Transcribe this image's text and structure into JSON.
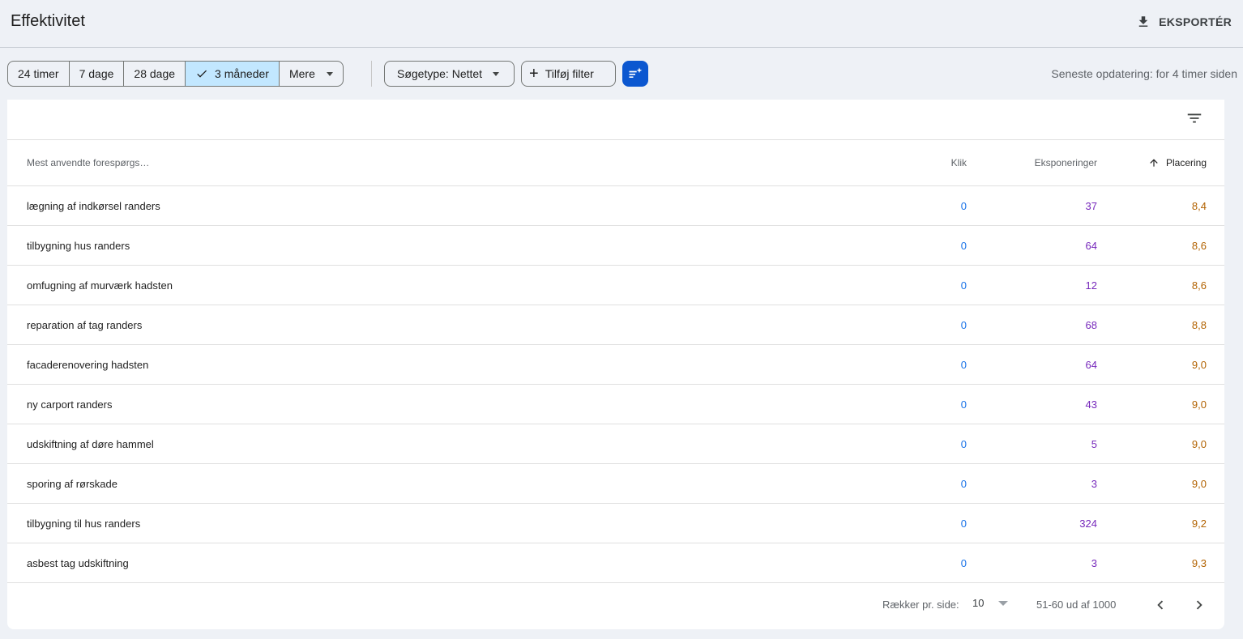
{
  "header": {
    "title": "Effektivitet",
    "export_label": "EKSPORTÉR"
  },
  "filters": {
    "date_ranges": [
      "24 timer",
      "7 dage",
      "28 dage",
      "3 måneder"
    ],
    "selected_range": "3 måneder",
    "more_label": "Mere",
    "search_type_label": "Søgetype: Nettet",
    "add_filter_label": "Tilføj filter",
    "last_update": "Seneste opdatering: for 4 timer siden"
  },
  "table": {
    "columns": {
      "query": "Mest anvendte forespørgs…",
      "clicks": "Klik",
      "impressions": "Eksponeringer",
      "position": "Placering"
    },
    "sort": {
      "column": "position",
      "direction": "ascending"
    },
    "rows": [
      {
        "query": "lægning af indkørsel randers",
        "clicks": "0",
        "impressions": "37",
        "position": "8,4"
      },
      {
        "query": "tilbygning hus randers",
        "clicks": "0",
        "impressions": "64",
        "position": "8,6"
      },
      {
        "query": "omfugning af murværk hadsten",
        "clicks": "0",
        "impressions": "12",
        "position": "8,6"
      },
      {
        "query": "reparation af tag randers",
        "clicks": "0",
        "impressions": "68",
        "position": "8,8"
      },
      {
        "query": "facaderenovering hadsten",
        "clicks": "0",
        "impressions": "64",
        "position": "9,0"
      },
      {
        "query": "ny carport randers",
        "clicks": "0",
        "impressions": "43",
        "position": "9,0"
      },
      {
        "query": "udskiftning af døre hammel",
        "clicks": "0",
        "impressions": "5",
        "position": "9,0"
      },
      {
        "query": "sporing af rørskade",
        "clicks": "0",
        "impressions": "3",
        "position": "9,0"
      },
      {
        "query": "tilbygning til hus randers",
        "clicks": "0",
        "impressions": "324",
        "position": "9,2"
      },
      {
        "query": "asbest tag udskiftning",
        "clicks": "0",
        "impressions": "3",
        "position": "9,3"
      }
    ]
  },
  "pagination": {
    "rows_per_page_label": "Rækker pr. side:",
    "rows_per_page": "10",
    "range": "51-60 ud af 1000"
  },
  "colors": {
    "clicks": "#1a73e8",
    "impressions": "#7627bb",
    "position": "#b26200",
    "selected_chip": "#c2e7ff",
    "primary_button": "#0b57d0"
  }
}
